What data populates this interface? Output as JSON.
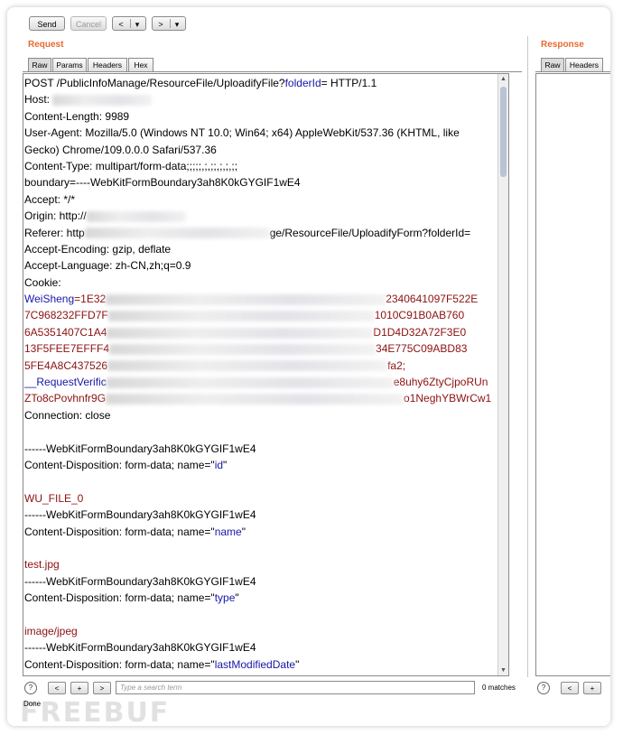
{
  "toolbar": {
    "send_label": "Send",
    "cancel_label": "Cancel",
    "back_label": "<",
    "forward_label": ">",
    "dropdown_glyph": "▾"
  },
  "request": {
    "title": "Request",
    "tabs": [
      "Raw",
      "Params",
      "Headers",
      "Hex"
    ],
    "active_tab": "Raw"
  },
  "response": {
    "title": "Response",
    "tabs": [
      "Raw",
      "Headers"
    ],
    "active_tab": "Raw"
  },
  "raw_lines": {
    "l1_a": "POST /PublicInfoManage/ResourceFile/UploadifyFile?",
    "l1_param": "folderId",
    "l1_b": "= HTTP/1.1",
    "l2": "Host: ",
    "l3": "Content-Length: 9989",
    "l4": "User-Agent: Mozilla/5.0 (Windows NT 10.0; Win64; x64) AppleWebKit/537.36 (KHTML, like",
    "l5": "Gecko) Chrome/109.0.0.0 Safari/537.36",
    "l6": "Content-Type: multipart/form-data;;;;;,;,;;,;,;,;;",
    "l7": "boundary=----WebKitFormBoundary3ah8K0kGYGIF1wE4",
    "l8": "Accept: */*",
    "l9": "Origin: http://",
    "l10_a": "Referer: http",
    "l10_b": "ge/ResourceFile/UploadifyForm?folderId=",
    "l11": "Accept-Encoding: gzip, deflate",
    "l12": "Accept-Language: zh-CN,zh;q=0.9",
    "l13": "Cookie:",
    "l14_name": "WeiSheng",
    "l14_a": "=1E32",
    "l14_b": "2340641097F522E",
    "l15_a": "7C968232FFD7F",
    "l15_b": "1010C91B0AB760",
    "l16_a": "6A5351407C1A4",
    "l16_b": "D1D4D32A72F3E0",
    "l17_a": "13F5FEE7EFFF4",
    "l17_b": "34E775C09ABD83",
    "l18_a": "5FE4A8C437526",
    "l18_b": "fa2;",
    "l19_name": "__RequestVerific",
    "l19_b": "e8uhy6ZtyCjpoRUn",
    "l20_a": "ZTo8cPovhnfr9G",
    "l20_b": "o1NeghYBWrCw1",
    "l21": "Connection: close",
    "l22": "",
    "l23": "------WebKitFormBoundary3ah8K0kGYGIF1wE4",
    "l24_a": "Content-Disposition: form-data; name=\"",
    "l24_name": "id",
    "l24_b": "\"",
    "l25": "",
    "l26": "WU_FILE_0",
    "l27": "------WebKitFormBoundary3ah8K0kGYGIF1wE4",
    "l28_a": "Content-Disposition: form-data; name=\"",
    "l28_name": "name",
    "l28_b": "\"",
    "l29": "",
    "l30": "test.jpg",
    "l31": "------WebKitFormBoundary3ah8K0kGYGIF1wE4",
    "l32_a": "Content-Disposition: form-data; name=\"",
    "l32_name": "type",
    "l32_b": "\"",
    "l33": "",
    "l34": "image/jpeg",
    "l35": "------WebKitFormBoundary3ah8K0kGYGIF1wE4",
    "l36_a": "Content-Disposition: form-data; name=\"",
    "l36_name": "lastModifiedDate",
    "l36_b": "\""
  },
  "search": {
    "help_glyph": "?",
    "prev_glyph": "<",
    "add_glyph": "+",
    "next_glyph": ">",
    "placeholder": "Type a search term",
    "matches": "0 matches"
  },
  "status": "Done",
  "watermark": "FREEBUF"
}
